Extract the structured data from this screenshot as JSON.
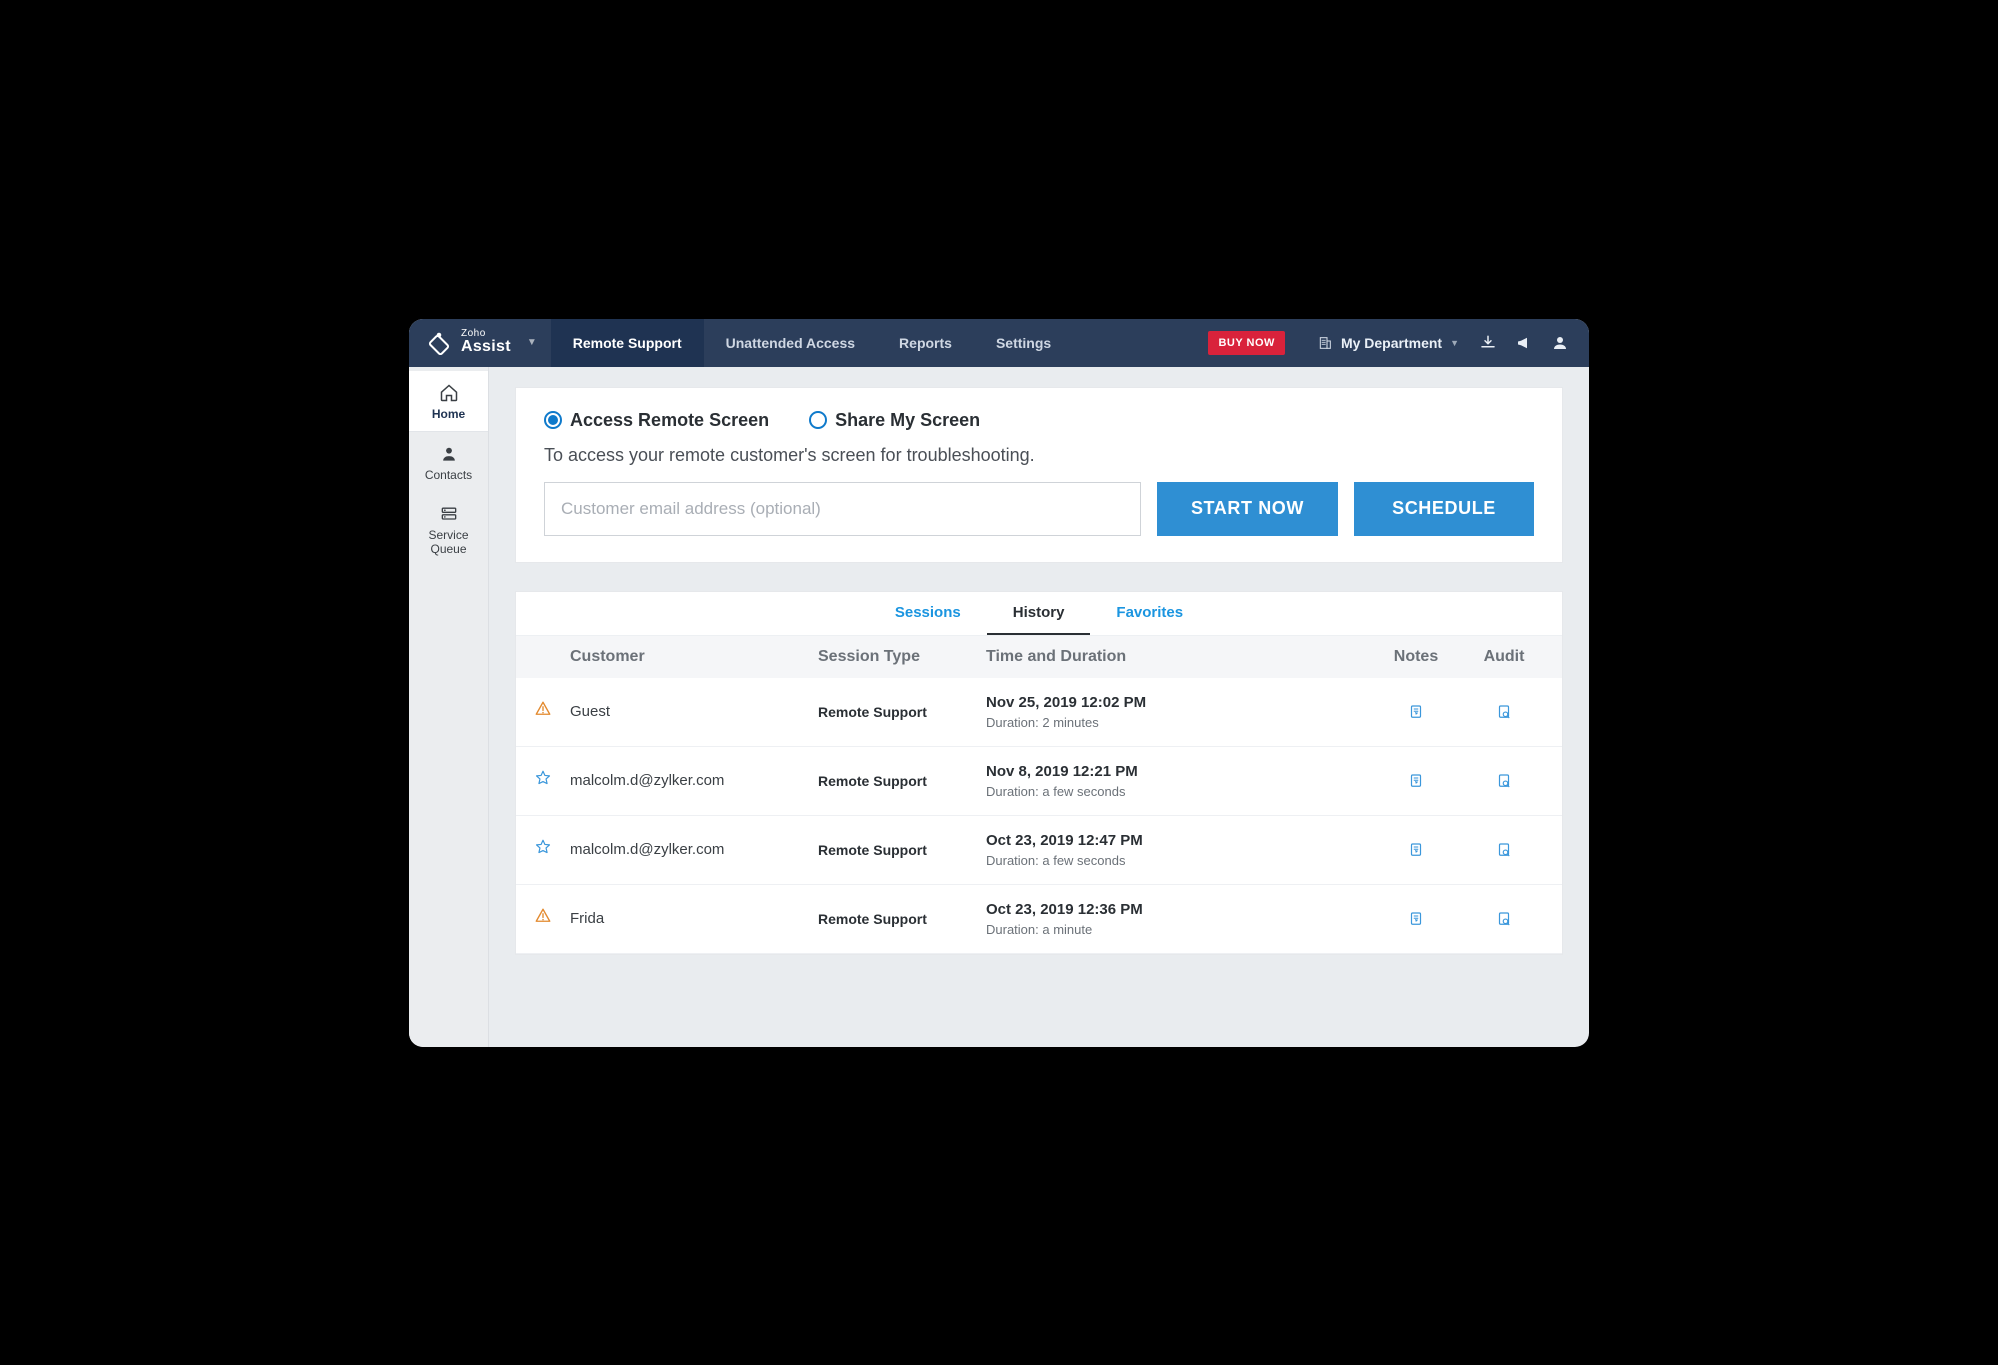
{
  "brand": {
    "top": "Zoho",
    "name": "Assist"
  },
  "nav": {
    "items": [
      "Remote Support",
      "Unattended Access",
      "Reports",
      "Settings"
    ],
    "active_index": 0
  },
  "buy_now": "BUY NOW",
  "department": "My Department",
  "sidebar": {
    "items": [
      {
        "label": "Home"
      },
      {
        "label": "Contacts"
      },
      {
        "label": "Service Queue"
      }
    ],
    "active_index": 0
  },
  "access": {
    "option_a": "Access Remote Screen",
    "option_b": "Share My Screen",
    "lead": "To access your remote customer's screen for troubleshooting.",
    "placeholder": "Customer email address (optional)",
    "start": "START NOW",
    "schedule": "SCHEDULE"
  },
  "panel_tabs": {
    "items": [
      "Sessions",
      "History",
      "Favorites"
    ],
    "active_index": 1
  },
  "table": {
    "headers": {
      "customer": "Customer",
      "type": "Session Type",
      "time": "Time and Duration",
      "notes": "Notes",
      "audit": "Audit"
    },
    "duration_prefix": "Duration: ",
    "rows": [
      {
        "icon": "warn",
        "customer": "Guest",
        "type": "Remote Support",
        "time": "Nov 25, 2019 12:02 PM",
        "duration": "2 minutes"
      },
      {
        "icon": "star",
        "customer": "malcolm.d@zylker.com",
        "type": "Remote Support",
        "time": "Nov 8, 2019 12:21 PM",
        "duration": "a few seconds"
      },
      {
        "icon": "star",
        "customer": "malcolm.d@zylker.com",
        "type": "Remote Support",
        "time": "Oct 23, 2019 12:47 PM",
        "duration": "a few seconds"
      },
      {
        "icon": "warn",
        "customer": "Frida",
        "type": "Remote Support",
        "time": "Oct 23, 2019 12:36 PM",
        "duration": "a minute"
      }
    ]
  }
}
